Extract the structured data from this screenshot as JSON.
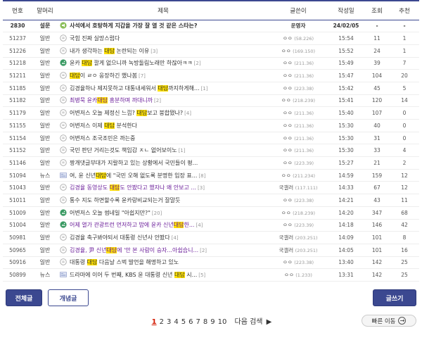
{
  "columns": {
    "num": "번호",
    "head": "말머리",
    "subject": "제목",
    "writer": "글쓴이",
    "date": "작성일",
    "views": "조회",
    "rec": "추천"
  },
  "rows": [
    {
      "num": "2830",
      "head": "설문",
      "icon": "survey-icon",
      "pre": "사석에서 호탕하게 지갑을 가장 잘 열 것 같은 스타는?",
      "hl": "",
      "post": "",
      "count": "",
      "writer": "운영자",
      "ip": "",
      "date": "24/02/05",
      "views": "-",
      "rec": "-",
      "visited": false,
      "notice": true
    },
    {
      "num": "51237",
      "head": "일반",
      "icon": "text-icon",
      "pre": "국힘 진짜 실망스럽다",
      "hl": "",
      "post": "",
      "count": "",
      "writer": "ㅇㅇ",
      "ip": "(58.226)",
      "date": "15:54",
      "views": "11",
      "rec": "1",
      "visited": false
    },
    {
      "num": "51226",
      "head": "일반",
      "icon": "text-icon",
      "pre": "내가 생각하는 ",
      "hl": "대담",
      "post": " 논란되는 이유",
      "count": "[3]",
      "writer": "ㅇㅇ",
      "ip": "(169.150)",
      "date": "15:52",
      "views": "24",
      "rec": "1",
      "visited": false
    },
    {
      "num": "51218",
      "head": "일반",
      "icon": "image-icon",
      "pre": "윤카 ",
      "hl": "대담",
      "post": " 깔게 없으니까 녹방돌림노래만 하잖아ㅋㅋ",
      "count": "[2]",
      "writer": "ㅇㅇ",
      "ip": "(211.36)",
      "date": "15:49",
      "views": "39",
      "rec": "7",
      "visited": false
    },
    {
      "num": "51211",
      "head": "일반",
      "icon": "text-icon",
      "pre": "",
      "hl": "대담",
      "post": "이 ㄹㅇ 웅장하긴 했나봄",
      "count": "[7]",
      "writer": "ㅇㅇ",
      "ip": "(211.36)",
      "date": "15:47",
      "views": "104",
      "rec": "20",
      "visited": false
    },
    {
      "num": "51185",
      "head": "일반",
      "icon": "text-icon",
      "pre": "김경율하나 제지못하고 대통내세워서 ",
      "hl": "대담",
      "post": "까지하게해...",
      "count": "[1]",
      "writer": "ㅇㅇ",
      "ip": "(223.38)",
      "date": "15:42",
      "views": "45",
      "rec": "5",
      "visited": false
    },
    {
      "num": "51182",
      "head": "일반",
      "icon": "text-icon",
      "pre": "최병묵 윤카",
      "hl": "대담",
      "post": " 흥분하며 까대니까",
      "count": "[2]",
      "writer": "ㅇㅇ",
      "ip": "(218.239)",
      "date": "15:41",
      "views": "120",
      "rec": "14",
      "visited": true
    },
    {
      "num": "51179",
      "head": "일반",
      "icon": "text-icon",
      "pre": "어변저스 오늘 제정신 느낌? ",
      "hl": "대담",
      "post": "보고 붕합됐나?",
      "count": "[4]",
      "writer": "ㅇㅇ",
      "ip": "(211.36)",
      "date": "15:40",
      "views": "107",
      "rec": "0",
      "visited": false
    },
    {
      "num": "51155",
      "head": "일반",
      "icon": "text-icon",
      "pre": "어변저스 이제 ",
      "hl": "대담",
      "post": " 분석한다",
      "count": "",
      "writer": "ㅇㅇ",
      "ip": "(211.36)",
      "date": "15:30",
      "views": "40",
      "rec": "0",
      "visited": false
    },
    {
      "num": "51154",
      "head": "일반",
      "icon": "text-icon",
      "pre": "어변저스 조국조민은 까는중",
      "hl": "",
      "post": "",
      "count": "",
      "writer": "ㅇㅇ",
      "ip": "(211.36)",
      "date": "15:30",
      "views": "31",
      "rec": "0",
      "visited": false
    },
    {
      "num": "51152",
      "head": "일반",
      "icon": "text-icon",
      "pre": "국민 판단 거리는것도 책임감 ㅈㄴ 없어보이노",
      "hl": "",
      "post": "",
      "count": "[1]",
      "writer": "ㅇㅇ",
      "ip": "(211.36)",
      "date": "15:30",
      "views": "33",
      "rec": "4",
      "visited": false
    },
    {
      "num": "51146",
      "head": "일반",
      "icon": "text-icon",
      "pre": "짱개댓글부대가 지랄하고 있는 상황에서 국민들이 평...",
      "hl": "",
      "post": "",
      "count": "",
      "writer": "ㅇㅇ",
      "ip": "(223.39)",
      "date": "15:27",
      "views": "21",
      "rec": "2",
      "visited": false
    },
    {
      "num": "51094",
      "head": "뉴스",
      "icon": "news-icon",
      "pre": "여, 윤 신년",
      "hl": "대담",
      "post": "에 \"국민 오해 없도록 분명한 입장 표...",
      "count": "[8]",
      "writer": "ㅇㅇ",
      "ip": "(211.234)",
      "date": "14:59",
      "views": "159",
      "rec": "12",
      "visited": false
    },
    {
      "num": "51043",
      "head": "일반",
      "icon": "text-icon",
      "pre": "김경율 동영상도 ",
      "hl": "대담",
      "post": "도 안봤다고 했자나 왜 안보고 ...",
      "count": "[3]",
      "writer": "국갤러",
      "ip": "(117.111)",
      "date": "14:33",
      "views": "67",
      "rec": "12",
      "visited": true
    },
    {
      "num": "51011",
      "head": "일반",
      "icon": "text-icon",
      "pre": "통수 지도 하면할수록 윤카랑비교되는거 잘말듯",
      "hl": "",
      "post": "",
      "count": "",
      "writer": "ㅇㅇ",
      "ip": "(223.38)",
      "date": "14:21",
      "views": "43",
      "rec": "11",
      "visited": false
    },
    {
      "num": "51009",
      "head": "일반",
      "icon": "image-icon",
      "pre": "어변저스 오늘 썸네일 \"아쉽지만?\"",
      "hl": "",
      "post": "",
      "count": "[20]",
      "writer": "ㅇㅇ",
      "ip": "(218.239)",
      "date": "14:20",
      "views": "347",
      "rec": "68",
      "visited": false
    },
    {
      "num": "51004",
      "head": "일반",
      "icon": "image-icon",
      "pre": "어제 열가 관광트런 먼저하고 밥에 윤카 신년",
      "hl": "대담",
      "post": "한...",
      "count": "[4]",
      "writer": "ㅇㅇ",
      "ip": "(223.39)",
      "date": "14:18",
      "views": "146",
      "rec": "42",
      "visited": true
    },
    {
      "num": "50981",
      "head": "일반",
      "icon": "text-icon",
      "pre": "김경율 축구봐야되서 대통령 신년사 안봤다",
      "hl": "",
      "post": "",
      "count": "[4]",
      "writer": "국갤러",
      "ip": "(203.251)",
      "date": "14:09",
      "views": "101",
      "rec": "8",
      "visited": false
    },
    {
      "num": "50965",
      "head": "일반",
      "icon": "text-icon",
      "pre": "김경율, 尹 신년",
      "hl": "대담",
      "post": "에 '안 본 사람이 승자...아쉽습니...",
      "count": "[2]",
      "writer": "국갤러",
      "ip": "(203.251)",
      "date": "14:05",
      "views": "101",
      "rec": "16",
      "visited": true
    },
    {
      "num": "50916",
      "head": "일반",
      "icon": "text-icon",
      "pre": "대통령 ",
      "hl": "대담",
      "post": " 다음날 스벅 발언을 해명하고 있노",
      "count": "",
      "writer": "ㅇㅇ",
      "ip": "(223.38)",
      "date": "13:40",
      "views": "142",
      "rec": "25",
      "visited": false
    },
    {
      "num": "50899",
      "head": "뉴스",
      "icon": "news-icon",
      "pre": "드라마에 이어 두 번째, KBS 윤 대통령 신년 ",
      "hl": "대담",
      "post": " 시...",
      "count": "[5]",
      "writer": "ㅇㅇ",
      "ip": "(1.233)",
      "date": "13:31",
      "views": "142",
      "rec": "25",
      "visited": false
    }
  ],
  "buttons": {
    "all": "전체글",
    "recommend": "개념글",
    "write": "글쓰기"
  },
  "paging": {
    "pages": [
      "1",
      "2",
      "3",
      "4",
      "5",
      "6",
      "7",
      "8",
      "9",
      "10"
    ],
    "current": "1",
    "next": "다음 검색"
  },
  "quick_move": "빠른 이동",
  "colors": {
    "accent": "#3b4890",
    "highlight": "#ffe000",
    "visited": "#6b1e9a",
    "current_page": "#d31900"
  }
}
